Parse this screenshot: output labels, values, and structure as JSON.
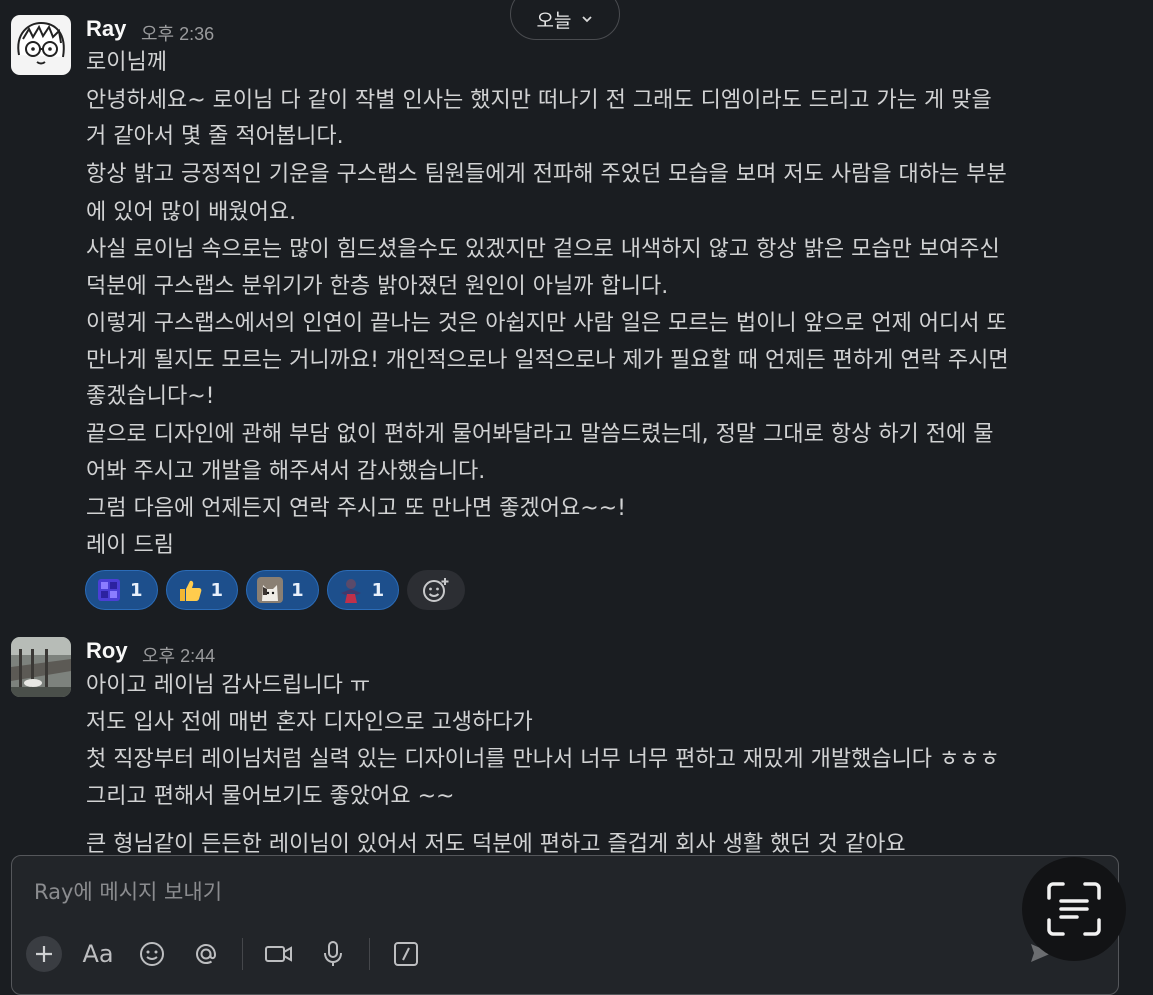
{
  "day_divider": {
    "label": "오늘"
  },
  "messages": [
    {
      "author": "Ray",
      "time": "오후 2:36",
      "lines": [
        "로이님께",
        "안녕하세요~ 로이님 다 같이 작별 인사는 했지만 떠나기 전 그래도 디엠이라도 드리고 가는 게 맞을",
        "거 같아서 몇 줄 적어봅니다.",
        "항상 밝고 긍정적인 기운을 구스랩스 팀원들에게 전파해 주었던 모습을 보며 저도 사람을 대하는 부분",
        "에 있어 많이 배웠어요.",
        "사실 로이님 속으로는 많이 힘드셨을수도 있겠지만 겉으로 내색하지 않고 항상 밝은 모습만 보여주신",
        "덕분에 구스랩스 분위기가 한층 밝아졌던 원인이 아닐까 합니다.",
        "이렇게 구스랩스에서의 인연이 끝나는 것은 아쉽지만 사람 일은 모르는 법이니 앞으로 언제 어디서 또",
        "만나게 될지도 모르는 거니까요! 개인적으로나 일적으로나 제가 필요할 때 언제든 편하게 연락 주시면",
        "좋겠습니다~!",
        "끝으로 디자인에 관해 부담 없이 편하게 물어봐달라고 말씀드렸는데, 정말 그대로 항상 하기 전에 물",
        "어봐 주시고 개발을 해주셔서 감사했습니다.",
        "그럼 다음에 언제든지 연락 주시고 또 만나면 좋겠어요~~!",
        "레이 드림"
      ],
      "reactions": [
        {
          "emoji": "grid-emoji",
          "count": "1"
        },
        {
          "emoji": "thumbs-up-emoji",
          "count": "1"
        },
        {
          "emoji": "cat-emoji",
          "count": "1"
        },
        {
          "emoji": "person-emoji",
          "count": "1"
        }
      ]
    },
    {
      "author": "Roy",
      "time": "오후 2:44",
      "lines": [
        "아이고 레이님 감사드립니다 ㅠ",
        "저도 입사 전에 매번 혼자 디자인으로 고생하다가",
        "첫 직장부터 레이님처럼 실력 있는 디자이너를 만나서 너무 너무 편하고 재밌게 개발했습니다 ㅎㅎㅎ",
        "그리고 편해서 물어보기도 좋았어요 ~~",
        "큰 형님같이 든든한 레이님이 있어서 저도 덕분에 편하고 즐겁게 회사 생활 했던 것 같아요"
      ]
    }
  ],
  "composer": {
    "placeholder": "Ray에 메시지 보내기",
    "tools": [
      "plus-icon",
      "format-icon",
      "emoji-icon",
      "mention-icon",
      "video-icon",
      "mic-icon",
      "slash-command-icon"
    ],
    "format_label": "Aa"
  },
  "colors": {
    "background": "#1a1d21",
    "reaction_bg": "#1d4f8c",
    "text": "#d1d2d3"
  }
}
